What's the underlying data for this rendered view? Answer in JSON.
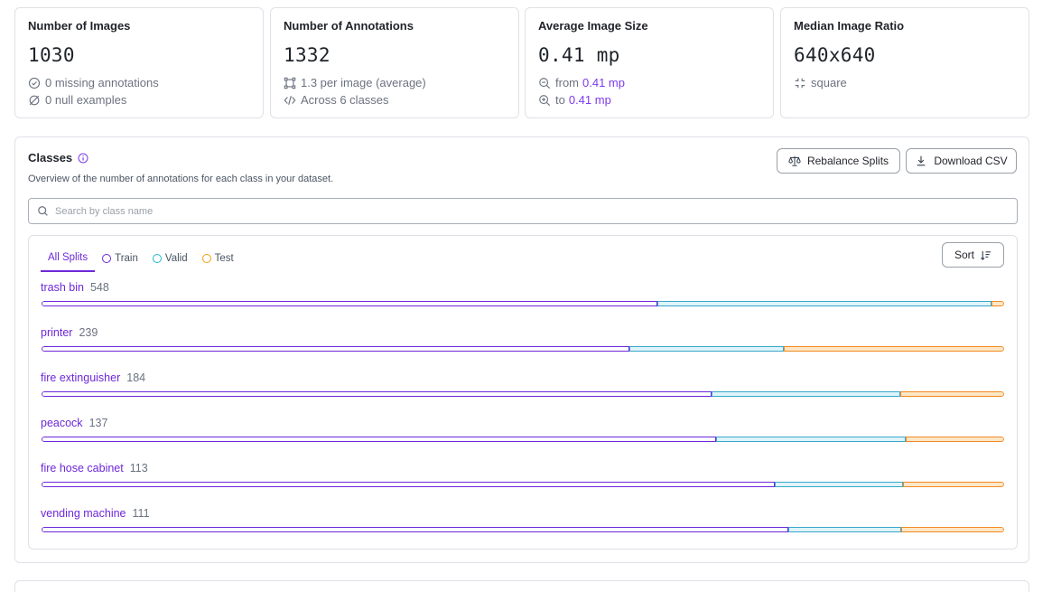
{
  "stats": [
    {
      "title": "Number of Images",
      "value": "1030",
      "lines": [
        {
          "icon": "check-circle-icon",
          "text": "0 missing annotations"
        },
        {
          "icon": "null-circle-icon",
          "text": "0 null examples"
        }
      ]
    },
    {
      "title": "Number of Annotations",
      "value": "1332",
      "lines": [
        {
          "icon": "bounding-box-icon",
          "text": "1.3 per image (average)"
        },
        {
          "icon": "code-icon",
          "text": "Across 6 classes"
        }
      ]
    },
    {
      "title": "Average Image Size",
      "value": "0.41 mp",
      "lines": [
        {
          "icon": "zoom-out-icon",
          "text": "from",
          "highlight": "0.41 mp"
        },
        {
          "icon": "zoom-in-icon",
          "text": "to",
          "highlight": "0.41 mp"
        }
      ]
    },
    {
      "title": "Median Image Ratio",
      "value": "640x640",
      "lines": [
        {
          "icon": "aspect-ratio-icon",
          "text": "square"
        }
      ]
    }
  ],
  "classes_section": {
    "title": "Classes",
    "subtitle": "Overview of the number of annotations for each class in your dataset.",
    "rebalance_label": "Rebalance Splits",
    "download_label": "Download CSV",
    "search_placeholder": "Search by class name",
    "tabs": [
      {
        "label": "All Splits",
        "active": true
      },
      {
        "label": "Train",
        "color": "#6d28d9"
      },
      {
        "label": "Valid",
        "color": "#22b8cf"
      },
      {
        "label": "Test",
        "color": "#f59e0b"
      }
    ],
    "sort_label": "Sort",
    "split_colors": {
      "train": {
        "fill": "#ffffff",
        "border": "#6d28d9"
      },
      "valid": {
        "fill": "#dff4fb",
        "border": "#3aa7c9"
      },
      "test": {
        "fill": "#fde7c6",
        "border": "#f08a24"
      }
    },
    "classes": [
      {
        "name": "trash bin",
        "count": "548",
        "train": 0.64,
        "valid": 0.347,
        "test": 0.013
      },
      {
        "name": "printer",
        "count": "239",
        "train": 0.611,
        "valid": 0.16,
        "test": 0.229
      },
      {
        "name": "fire extinguisher",
        "count": "184",
        "train": 0.696,
        "valid": 0.196,
        "test": 0.108
      },
      {
        "name": "peacock",
        "count": "137",
        "train": 0.701,
        "valid": 0.197,
        "test": 0.102
      },
      {
        "name": "fire hose cabinet",
        "count": "113",
        "train": 0.762,
        "valid": 0.133,
        "test": 0.105
      },
      {
        "name": "vending machine",
        "count": "111",
        "train": 0.776,
        "valid": 0.117,
        "test": 0.107
      }
    ]
  }
}
